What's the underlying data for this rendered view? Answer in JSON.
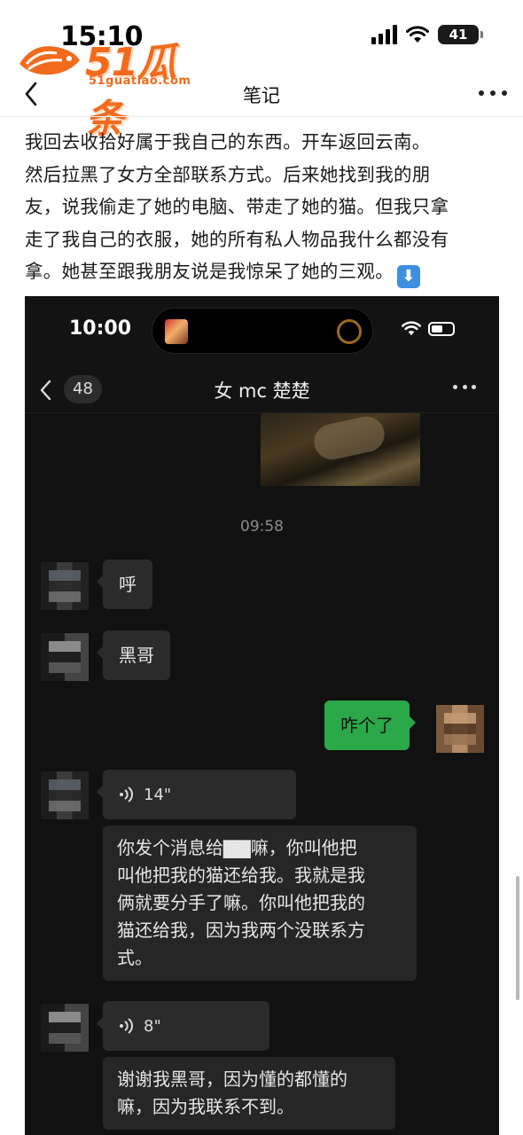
{
  "status_bar": {
    "time": "15:10",
    "battery": "41"
  },
  "watermark": {
    "logo_text": "51瓜条",
    "site": "51guatiao.com"
  },
  "nav": {
    "title": "笔记"
  },
  "article": {
    "lines": [
      "我回去收拾好属于我自己的东西。开车返回云南。",
      "然后拉黑了女方全部联系方式。后来她找到我的朋",
      "友，说我偷走了她的电脑、带走了她的猫。但我只拿",
      "走了我自己的衣服，她的所有私人物品我什么都没有",
      "拿。她甚至跟我朋友说是我惊呆了她的三观。"
    ],
    "emoji": "⬇"
  },
  "screenshot": {
    "status_time": "10:00",
    "chat": {
      "back_badge": "48",
      "title": "女 mc 楚楚",
      "timestamp": "09:58",
      "messages": [
        {
          "from": "them",
          "text": "呼"
        },
        {
          "from": "them",
          "text": "黑哥"
        },
        {
          "from": "me",
          "text": "咋个了"
        },
        {
          "from": "them",
          "voice_duration": "14\"",
          "transcript": [
            "你发个消息给▇▇嘛，你叫他把",
            "叫他把我的猫还给我。我就是我",
            "俩就要分手了嘛。你叫他把我的",
            "猫还给我，因为我两个没联系方",
            "式。"
          ]
        },
        {
          "from": "them",
          "voice_duration": "8\"",
          "transcript": [
            "谢谢我黑哥，因为懂的都懂的",
            "嘛，因为我联系不到。"
          ]
        }
      ]
    }
  }
}
